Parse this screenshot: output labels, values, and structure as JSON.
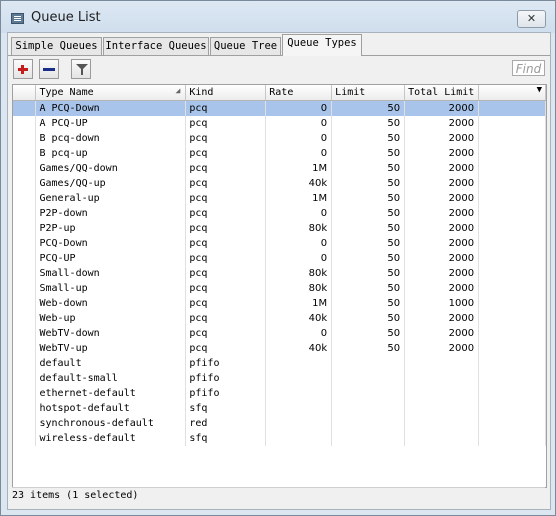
{
  "window": {
    "title": "Queue List",
    "close_label": "✕"
  },
  "tabs": [
    {
      "label": "Simple Queues"
    },
    {
      "label": "Interface Queues"
    },
    {
      "label": "Queue Tree"
    },
    {
      "label": "Queue Types"
    }
  ],
  "toolbar": {
    "find_placeholder": "Find"
  },
  "columns": [
    "Type Name",
    "Kind",
    "Rate",
    "Limit",
    "Total Limit"
  ],
  "rows": [
    {
      "name": "A PCQ-Down",
      "kind": "pcq",
      "rate": "0",
      "limit": "50",
      "total": "2000",
      "selected": true
    },
    {
      "name": "A PCQ-UP",
      "kind": "pcq",
      "rate": "0",
      "limit": "50",
      "total": "2000"
    },
    {
      "name": "B pcq-down",
      "kind": "pcq",
      "rate": "0",
      "limit": "50",
      "total": "2000"
    },
    {
      "name": "B pcq-up",
      "kind": "pcq",
      "rate": "0",
      "limit": "50",
      "total": "2000"
    },
    {
      "name": "Games/QQ-down",
      "kind": "pcq",
      "rate": "1M",
      "limit": "50",
      "total": "2000"
    },
    {
      "name": "Games/QQ-up",
      "kind": "pcq",
      "rate": "40k",
      "limit": "50",
      "total": "2000"
    },
    {
      "name": "General-up",
      "kind": "pcq",
      "rate": "1M",
      "limit": "50",
      "total": "2000"
    },
    {
      "name": "P2P-down",
      "kind": "pcq",
      "rate": "0",
      "limit": "50",
      "total": "2000"
    },
    {
      "name": "P2P-up",
      "kind": "pcq",
      "rate": "80k",
      "limit": "50",
      "total": "2000"
    },
    {
      "name": "PCQ-Down",
      "kind": "pcq",
      "rate": "0",
      "limit": "50",
      "total": "2000"
    },
    {
      "name": "PCQ-UP",
      "kind": "pcq",
      "rate": "0",
      "limit": "50",
      "total": "2000"
    },
    {
      "name": "Small-down",
      "kind": "pcq",
      "rate": "80k",
      "limit": "50",
      "total": "2000"
    },
    {
      "name": "Small-up",
      "kind": "pcq",
      "rate": "80k",
      "limit": "50",
      "total": "2000"
    },
    {
      "name": "Web-down",
      "kind": "pcq",
      "rate": "1M",
      "limit": "50",
      "total": "1000"
    },
    {
      "name": "Web-up",
      "kind": "pcq",
      "rate": "40k",
      "limit": "50",
      "total": "2000"
    },
    {
      "name": "WebTV-down",
      "kind": "pcq",
      "rate": "0",
      "limit": "50",
      "total": "2000"
    },
    {
      "name": "WebTV-up",
      "kind": "pcq",
      "rate": "40k",
      "limit": "50",
      "total": "2000"
    },
    {
      "name": "default",
      "kind": "pfifo",
      "rate": "",
      "limit": "",
      "total": ""
    },
    {
      "name": "default-small",
      "kind": "pfifo",
      "rate": "",
      "limit": "",
      "total": ""
    },
    {
      "name": "ethernet-default",
      "kind": "pfifo",
      "rate": "",
      "limit": "",
      "total": ""
    },
    {
      "name": "hotspot-default",
      "kind": "sfq",
      "rate": "",
      "limit": "",
      "total": ""
    },
    {
      "name": "synchronous-default",
      "kind": "red",
      "rate": "",
      "limit": "",
      "total": ""
    },
    {
      "name": "wireless-default",
      "kind": "sfq",
      "rate": "",
      "limit": "",
      "total": ""
    }
  ],
  "status": "23 items (1 selected)",
  "colors": {
    "selected_row": "#a8c4ea",
    "add_icon": "#c71b1b",
    "remove_icon": "#1b2f8a"
  }
}
